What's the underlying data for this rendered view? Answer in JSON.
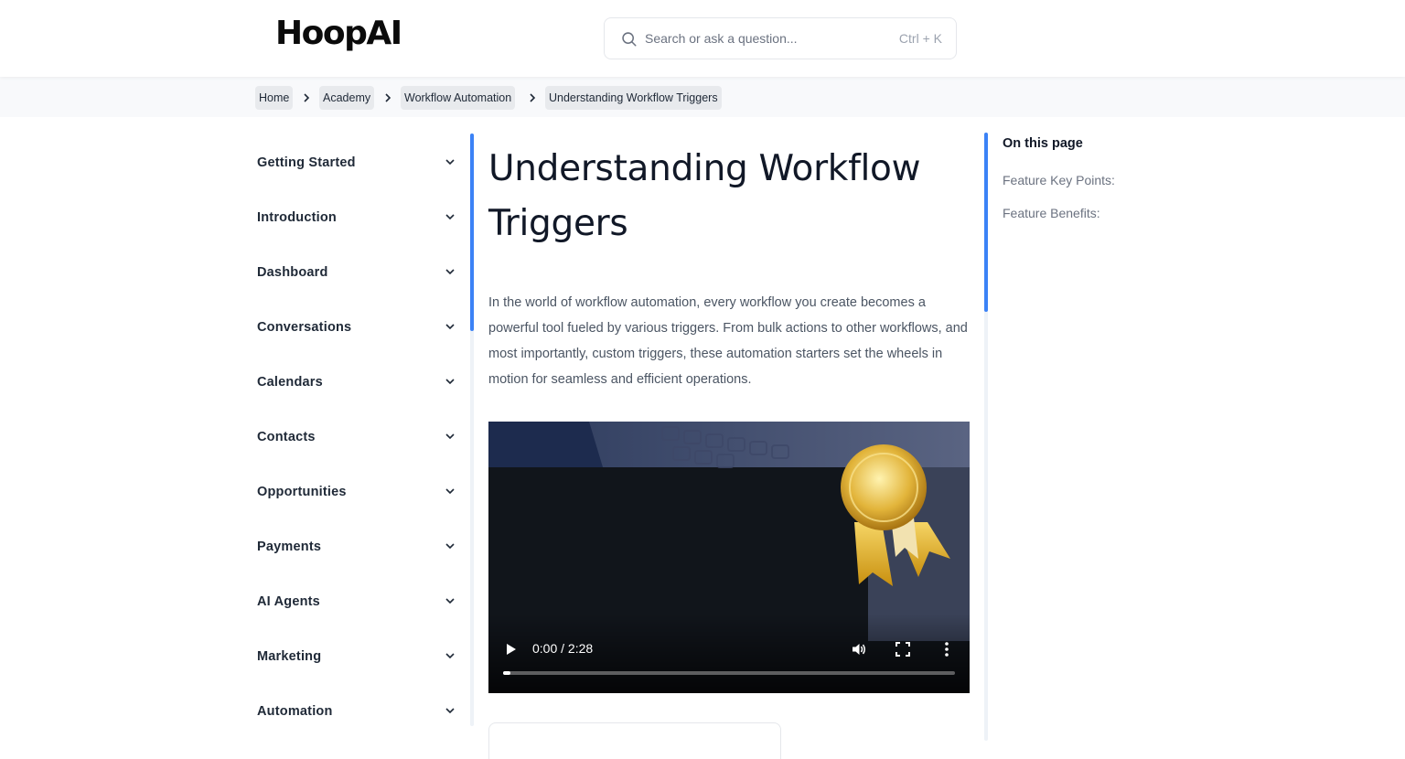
{
  "header": {
    "logo": "HoopAI",
    "search": {
      "placeholder": "Search or ask a question...",
      "shortcut": "Ctrl + K"
    }
  },
  "breadcrumb": [
    {
      "label": "Home"
    },
    {
      "label": "Academy"
    },
    {
      "label": "Workflow Automation"
    },
    {
      "label": "Understanding Workflow Triggers"
    }
  ],
  "sidebar": {
    "items": [
      {
        "label": "Getting Started"
      },
      {
        "label": "Introduction"
      },
      {
        "label": "Dashboard"
      },
      {
        "label": "Conversations"
      },
      {
        "label": "Calendars"
      },
      {
        "label": "Contacts"
      },
      {
        "label": "Opportunities"
      },
      {
        "label": "Payments"
      },
      {
        "label": "AI Agents"
      },
      {
        "label": "Marketing"
      },
      {
        "label": "Automation"
      }
    ]
  },
  "article": {
    "title": "Understanding Workflow Triggers",
    "intro": "In the world of workflow automation, every workflow you create becomes a powerful tool fueled by various triggers. From bulk actions to other workflows, and most importantly, custom triggers, these automation starters set the wheels in motion for seamless and efficient operations."
  },
  "video": {
    "time": "0:00 / 2:28",
    "progress_fraction": 0.0
  },
  "toc": {
    "title": "On this page",
    "links": [
      {
        "label": "Feature Key Points:"
      },
      {
        "label": "Feature Benefits:"
      }
    ]
  },
  "colors": {
    "accent": "#3b82f6",
    "text": "#1f2937",
    "muted": "#6b7280"
  }
}
